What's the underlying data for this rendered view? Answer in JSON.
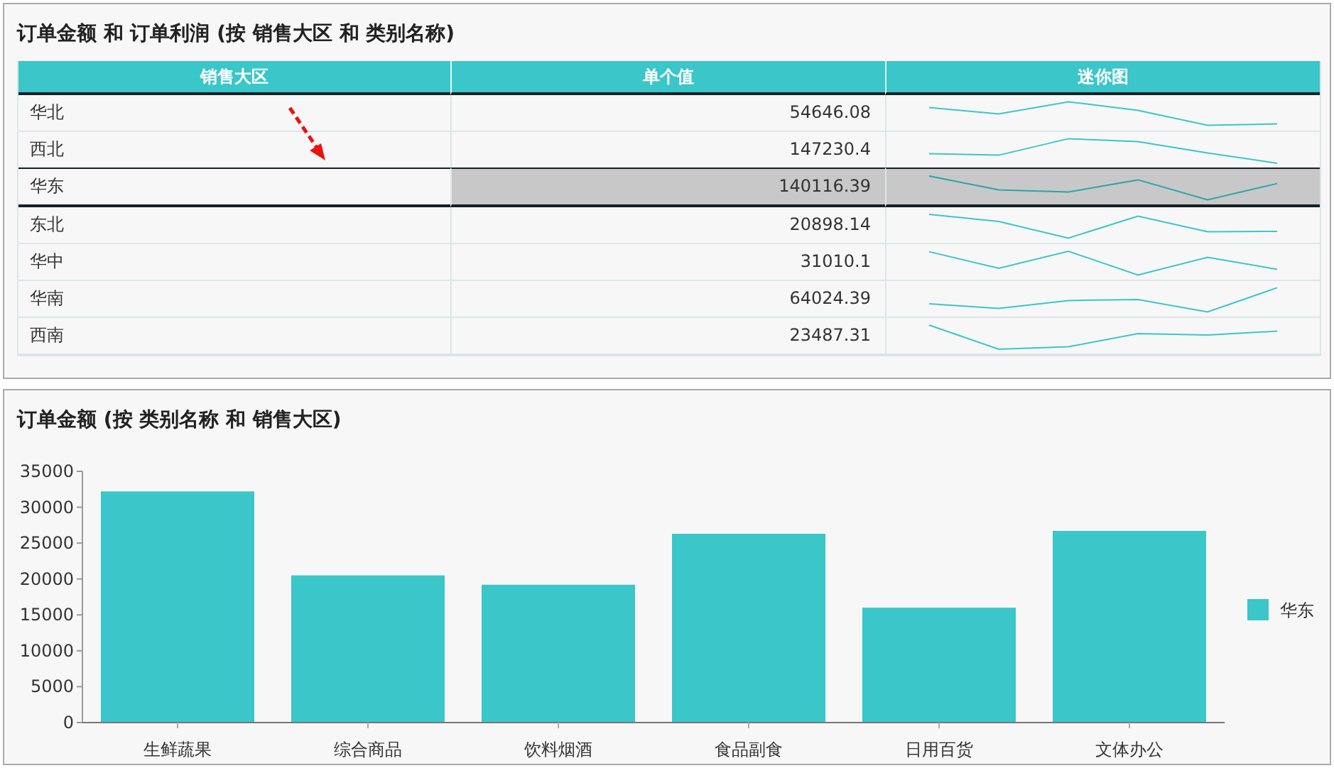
{
  "top_panel": {
    "title": "订单金额 和 订单利润 (按 销售大区 和 类别名称)",
    "table": {
      "columns": [
        "销售大区",
        "单个值",
        "迷你图"
      ],
      "rows": [
        {
          "region": "华北",
          "value": "54646.08",
          "selected": false
        },
        {
          "region": "西北",
          "value": "147230.4",
          "selected": false
        },
        {
          "region": "华东",
          "value": "140116.39",
          "selected": true
        },
        {
          "region": "东北",
          "value": "20898.14",
          "selected": false
        },
        {
          "region": "华中",
          "value": "31010.1",
          "selected": false
        },
        {
          "region": "华南",
          "value": "64024.39",
          "selected": false
        },
        {
          "region": "西南",
          "value": "23487.31",
          "selected": false
        }
      ]
    }
  },
  "bottom_panel": {
    "title": "订单金额 (按 类别名称 和 销售大区)",
    "chart_data": {
      "type": "bar",
      "categories": [
        "生鲜蔬果",
        "综合商品",
        "饮料烟酒",
        "食品副食",
        "日用百货",
        "文体办公"
      ],
      "series": [
        {
          "name": "华东",
          "color": "#3bc6c9",
          "values": [
            32200,
            20500,
            19200,
            26300,
            16000,
            26700
          ]
        }
      ],
      "ylim": [
        0,
        35000
      ],
      "yticks": [
        0,
        5000,
        10000,
        15000,
        20000,
        25000,
        30000,
        35000
      ]
    }
  }
}
